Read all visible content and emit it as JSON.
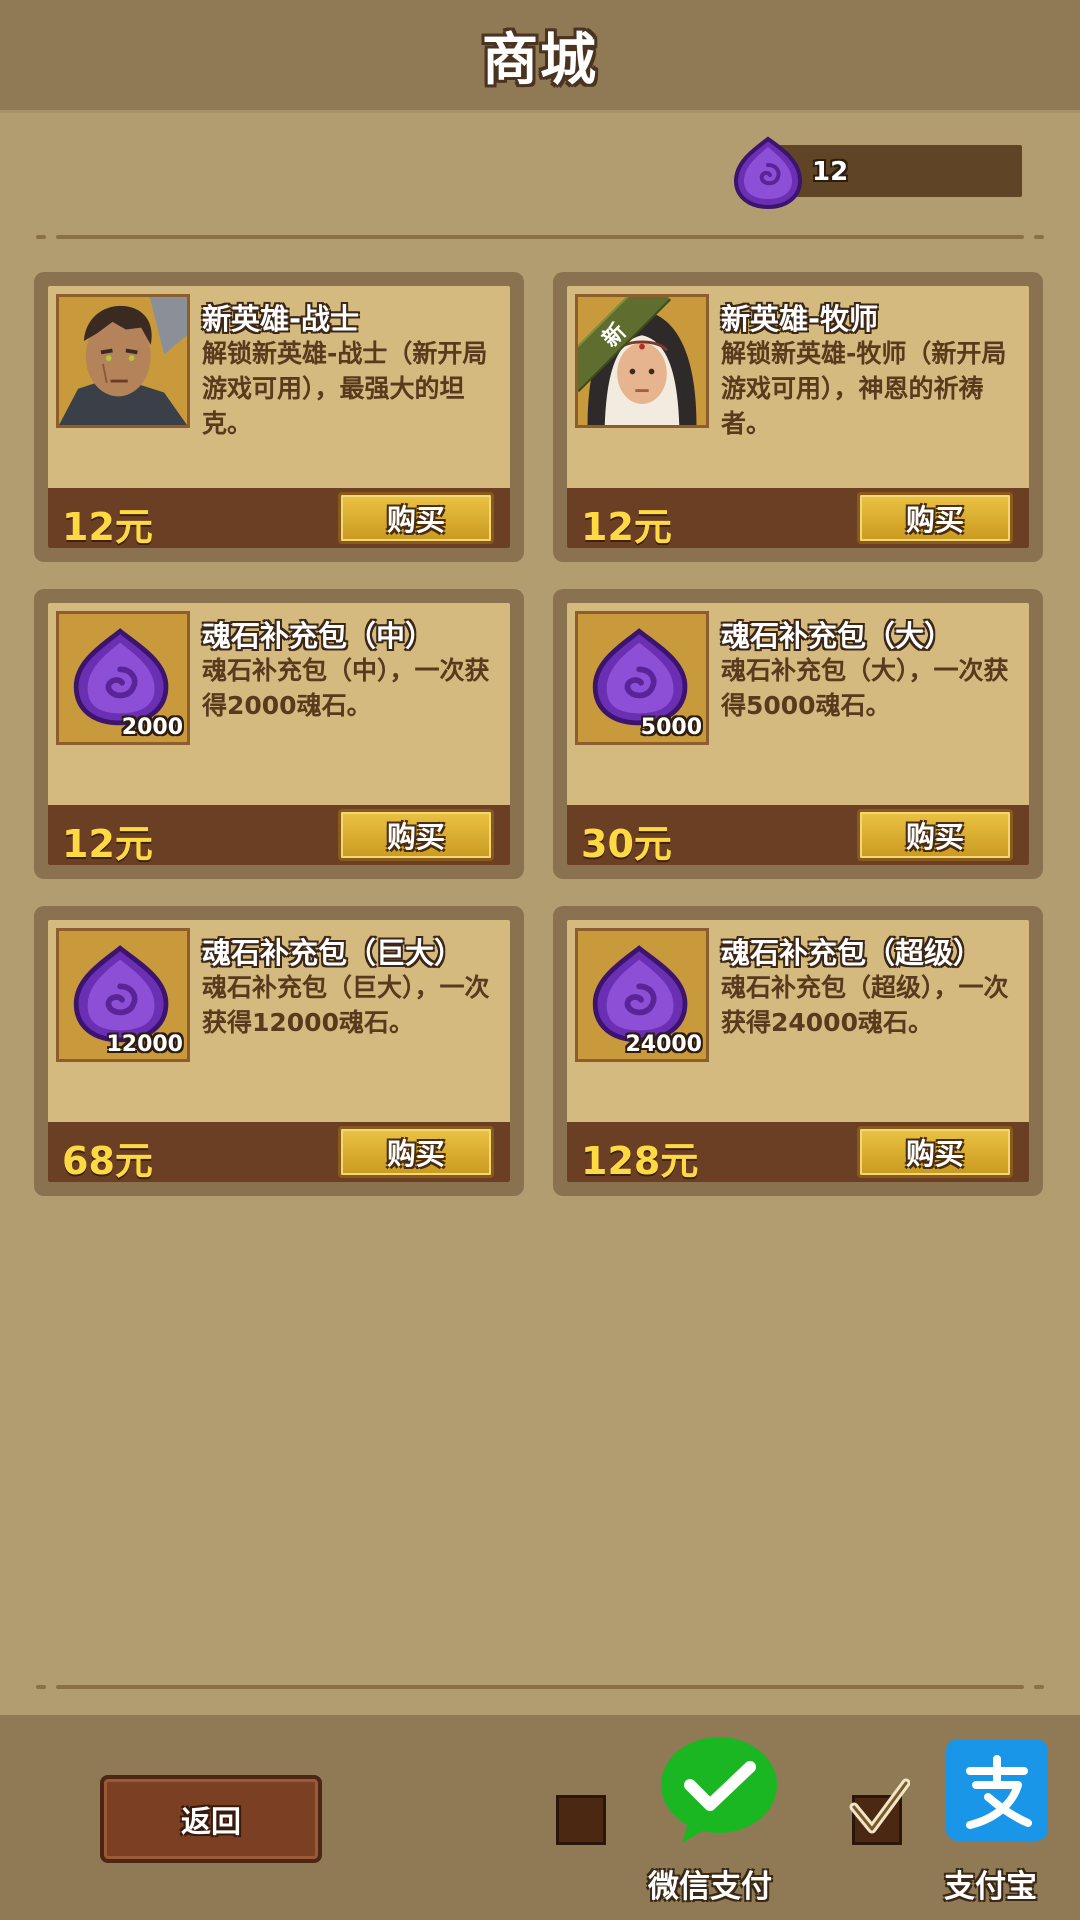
{
  "header": {
    "title": "商城"
  },
  "currency": {
    "icon": "soul-stone-icon",
    "amount": "12"
  },
  "products": [
    {
      "name": "新英雄-战士",
      "desc": "解锁新英雄-战士（新开局游戏可用），最强大的坦克。",
      "price": "12元",
      "buy_label": "购买",
      "icon": "warrior-portrait"
    },
    {
      "name": "新英雄-牧师",
      "desc": "解锁新英雄-牧师（新开局游戏可用），神恩的祈祷者。",
      "price": "12元",
      "buy_label": "购买",
      "icon": "priest-portrait",
      "badge": "新"
    },
    {
      "name": "魂石补充包（中）",
      "desc": "魂石补充包（中），一次获得2000魂石。",
      "price": "12元",
      "buy_label": "购买",
      "icon": "soul-stone-icon",
      "qty": "2000"
    },
    {
      "name": "魂石补充包（大）",
      "desc": "魂石补充包（大），一次获得5000魂石。",
      "price": "30元",
      "buy_label": "购买",
      "icon": "soul-stone-icon",
      "qty": "5000"
    },
    {
      "name": "魂石补充包（巨大）",
      "desc": "魂石补充包（巨大），一次获得12000魂石。",
      "price": "68元",
      "buy_label": "购买",
      "icon": "soul-stone-icon",
      "qty": "12000"
    },
    {
      "name": "魂石补充包（超级）",
      "desc": "魂石补充包（超级），一次获得24000魂石。",
      "price": "128元",
      "buy_label": "购买",
      "icon": "soul-stone-icon",
      "qty": "24000"
    }
  ],
  "footer": {
    "back_label": "返回",
    "wechat": {
      "label": "微信支付",
      "checked": false,
      "color": "#1bb722"
    },
    "alipay": {
      "label": "支付宝",
      "checked": true,
      "color": "#1a96e8"
    }
  },
  "colors": {
    "background": "#b29d70",
    "header": "#8f7a55",
    "price": "#ffd944",
    "button": "#d8ab2f"
  }
}
